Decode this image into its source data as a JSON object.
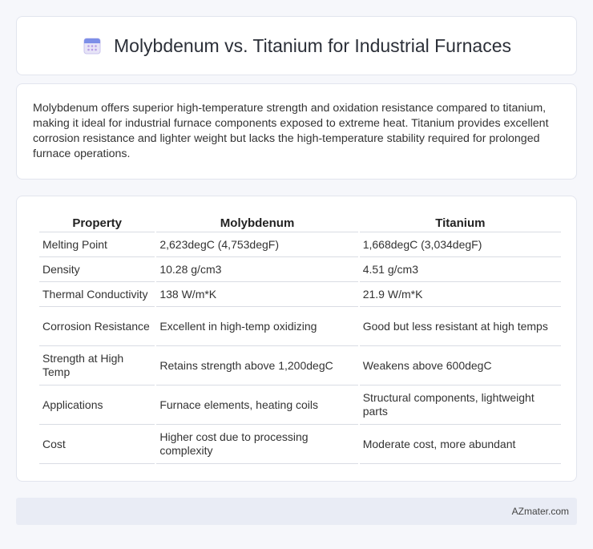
{
  "header": {
    "title": "Molybdenum vs. Titanium for Industrial Furnaces",
    "icon": "calendar-icon"
  },
  "summary": {
    "text": "Molybdenum offers superior high-temperature strength and oxidation resistance compared to titanium, making it ideal for industrial furnace components exposed to extreme heat. Titanium provides excellent corrosion resistance and lighter weight but lacks the high-temperature stability required for prolonged furnace operations."
  },
  "table": {
    "headers": [
      "Property",
      "Molybdenum",
      "Titanium"
    ],
    "rows": [
      [
        "Melting Point",
        "2,623degC (4,753degF)",
        "1,668degC (3,034degF)"
      ],
      [
        "Density",
        "10.28 g/cm3",
        "4.51 g/cm3"
      ],
      [
        "Thermal Conductivity",
        "138 W/m*K",
        "21.9 W/m*K"
      ],
      [
        "Corrosion Resistance",
        "Excellent in high-temp oxidizing",
        "Good but less resistant at high temps"
      ],
      [
        "Strength at High Temp",
        "Retains strength above 1,200degC",
        "Weakens above 600degC"
      ],
      [
        "Applications",
        "Furnace elements, heating coils",
        "Structural components, lightweight parts"
      ],
      [
        "Cost",
        "Higher cost due to processing complexity",
        "Moderate cost, more abundant"
      ]
    ]
  },
  "footer": {
    "brand": "AZmater.com"
  }
}
